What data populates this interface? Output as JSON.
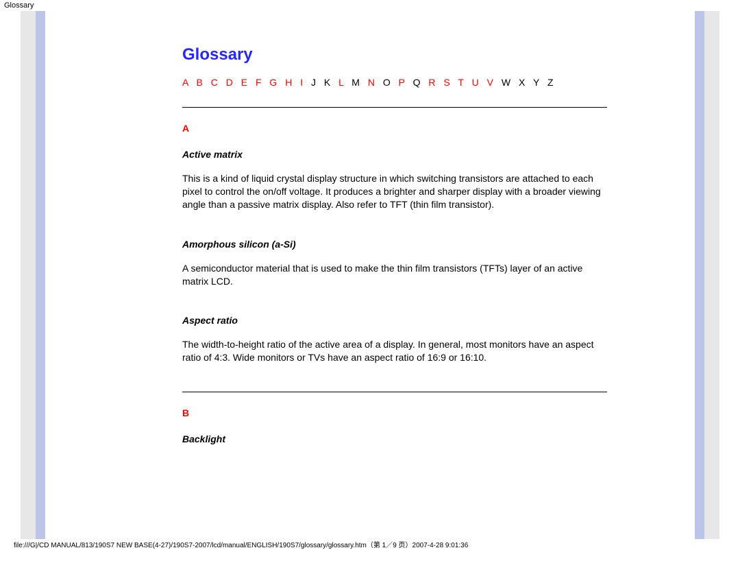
{
  "top_label": "Glossary",
  "title": "Glossary",
  "alpha_index": [
    {
      "ch": "A",
      "link": true
    },
    {
      "ch": "B",
      "link": true
    },
    {
      "ch": "C",
      "link": true
    },
    {
      "ch": "D",
      "link": true
    },
    {
      "ch": "E",
      "link": true
    },
    {
      "ch": "F",
      "link": true
    },
    {
      "ch": "G",
      "link": true
    },
    {
      "ch": "H",
      "link": true
    },
    {
      "ch": "I",
      "link": true
    },
    {
      "ch": "J",
      "link": false
    },
    {
      "ch": "K",
      "link": false
    },
    {
      "ch": "L",
      "link": true
    },
    {
      "ch": "M",
      "link": false
    },
    {
      "ch": "N",
      "link": true
    },
    {
      "ch": "O",
      "link": false
    },
    {
      "ch": "P",
      "link": true
    },
    {
      "ch": "Q",
      "link": false
    },
    {
      "ch": "R",
      "link": true
    },
    {
      "ch": "S",
      "link": true
    },
    {
      "ch": "T",
      "link": true
    },
    {
      "ch": "U",
      "link": true
    },
    {
      "ch": "V",
      "link": true
    },
    {
      "ch": "W",
      "link": false
    },
    {
      "ch": "X",
      "link": false
    },
    {
      "ch": "Y",
      "link": false
    },
    {
      "ch": "Z",
      "link": false
    }
  ],
  "sections": [
    {
      "letter": "A",
      "entries": [
        {
          "term": "Active matrix",
          "def": "This is a kind of liquid crystal display structure in which switching transistors are attached to each pixel to control the on/off voltage. It produces a brighter and sharper display with a broader viewing angle than a passive matrix display. Also refer to TFT (thin film transistor)."
        },
        {
          "term": "Amorphous silicon (a-Si)",
          "def": "A semiconductor material that is used to make the thin film transistors (TFTs) layer of an active matrix LCD."
        },
        {
          "term": "Aspect ratio",
          "def": "The width-to-height ratio of the active area of a display. In general, most monitors have an aspect ratio of 4:3. Wide monitors or TVs have an aspect ratio of 16:9 or 16:10."
        }
      ]
    },
    {
      "letter": "B",
      "entries": [
        {
          "term": "Backlight",
          "def": ""
        }
      ]
    }
  ],
  "footer_path": "file:///G|/CD MANUAL/813/190S7 NEW BASE(4-27)/190S7-2007/lcd/manual/ENGLISH/190S7/glossary/glossary.htm（第 1／9 页）2007-4-28 9:01:36"
}
